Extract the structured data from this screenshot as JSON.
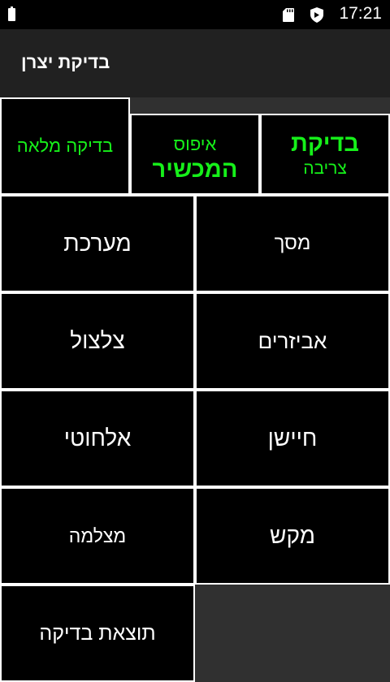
{
  "status_bar": {
    "time": "17:21",
    "icons": [
      "battery-icon",
      "sd-card-icon",
      "shield-icon"
    ]
  },
  "app_bar": {
    "title": "בדיקת יצרן"
  },
  "top_buttons": {
    "full_test": "בדיקה מלאה",
    "reset_device": {
      "line1": "איפוס",
      "line2": "המכשיר"
    },
    "burn_in_test": {
      "line1": "בדיקת",
      "line2": "צריבה"
    }
  },
  "grid": {
    "system": "מערכת",
    "screen": "מסך",
    "ringing": "צלצול",
    "accessories": "אביזרים",
    "wireless": "אלחוטי",
    "sensor": "חיישן",
    "camera": "מצלמה",
    "keys": "מקש",
    "test_result": "תוצאת בדיקה"
  },
  "colors": {
    "accent_green": "#16f01a",
    "background": "#303030",
    "app_bar": "#212121",
    "button_bg": "#000000",
    "button_border": "#ffffff"
  }
}
